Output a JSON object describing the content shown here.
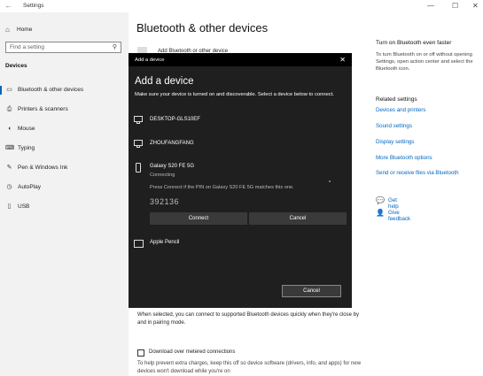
{
  "window": {
    "title": "Settings",
    "back_glyph": "←",
    "min_glyph": "—",
    "max_glyph": "☐",
    "close_glyph": "✕"
  },
  "sidebar": {
    "home_label": "Home",
    "search_placeholder": "Find a setting",
    "section_title": "Devices",
    "items": [
      {
        "label": "Bluetooth & other devices",
        "icon": "bluetooth-icon",
        "selected": true
      },
      {
        "label": "Printers & scanners",
        "icon": "printer-icon"
      },
      {
        "label": "Mouse",
        "icon": "mouse-icon"
      },
      {
        "label": "Typing",
        "icon": "keyboard-icon"
      },
      {
        "label": "Pen & Windows Ink",
        "icon": "pen-icon"
      },
      {
        "label": "AutoPlay",
        "icon": "autoplay-icon"
      },
      {
        "label": "USB",
        "icon": "usb-icon"
      }
    ]
  },
  "main": {
    "title": "Bluetooth & other devices",
    "add_device_label": "Add Bluetooth or other device",
    "swift_pair_text": "When selected, you can connect to supported Bluetooth devices quickly when they're close by and in pairing mode.",
    "metered_label": "Download over metered connections",
    "metered_text": "To help prevent extra charges, keep this off so device software (drivers, info, and apps) for new devices won't download while you're on"
  },
  "right": {
    "turn_on_title": "Turn on Bluetooth even faster",
    "turn_on_text": "To turn Bluetooth on or off without opening Settings, open action center and select the Bluetooth icon.",
    "related_title": "Related settings",
    "links": [
      "Devices and printers",
      "Sound settings",
      "Display settings",
      "More Bluetooth options",
      "Send or receive files via Bluetooth"
    ],
    "get_help": "Get help",
    "give_feedback": "Give feedback"
  },
  "dialog": {
    "title_bar": "Add a device",
    "heading": "Add a device",
    "subtitle": "Make sure your device is turned on and discoverable. Select a device below to connect.",
    "devices": [
      {
        "name": "DESKTOP-GLS10EF",
        "icon": "computer-icon"
      },
      {
        "name": "ZHOUFANGFANG",
        "icon": "computer-icon"
      },
      {
        "name": "Galaxy S20 FE 5G",
        "icon": "phone-icon"
      },
      {
        "name": "Apple Pencil",
        "icon": "input-device-icon"
      }
    ],
    "connecting": "Connecting",
    "pin_instruction": "Press Connect if the PIN on Galaxy S20 FE 5G matches this one.",
    "pin": "392136",
    "connect_label": "Connect",
    "cancel_label": "Cancel",
    "footer_cancel": "Cancel"
  }
}
